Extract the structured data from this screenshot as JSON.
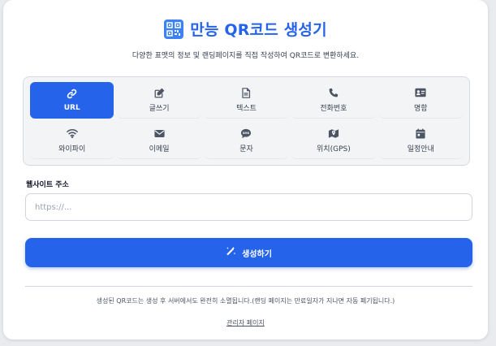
{
  "header": {
    "title": "만능 QR코드 생성기",
    "subtitle": "다양한 표맷의 정보 및 랜딩페이지를 직접 작성하여 QR코드로 변환하세요.",
    "logo_icon": "qr-code-icon"
  },
  "types": [
    {
      "label": "URL",
      "icon": "link-icon",
      "active": true
    },
    {
      "label": "글쓰기",
      "icon": "edit-icon",
      "active": false
    },
    {
      "label": "텍스트",
      "icon": "document-icon",
      "active": false
    },
    {
      "label": "전화번호",
      "icon": "phone-icon",
      "active": false
    },
    {
      "label": "명함",
      "icon": "id-card-icon",
      "active": false
    },
    {
      "label": "와이파이",
      "icon": "wifi-icon",
      "active": false
    },
    {
      "label": "이메일",
      "icon": "envelope-icon",
      "active": false
    },
    {
      "label": "문자",
      "icon": "sms-icon",
      "active": false
    },
    {
      "label": "위치(GPS)",
      "icon": "map-icon",
      "active": false
    },
    {
      "label": "일정안내",
      "icon": "calendar-icon",
      "active": false
    }
  ],
  "form": {
    "field_label": "웹사이트 주소",
    "placeholder": "https://...",
    "value": ""
  },
  "generate": {
    "label": "생성하기",
    "icon": "magic-wand-icon"
  },
  "footer": {
    "notice": "생성된 QR코드는 생성 후 서버에서도 완전히 소멸됩니다.(랜딩 페이지는 만료일자가 지나면 자동 폐기됩니다.)",
    "admin_link": "관리자 페이지"
  },
  "colors": {
    "accent": "#2563eb",
    "background": "#e9ebee",
    "panel": "#f3f4f6"
  }
}
